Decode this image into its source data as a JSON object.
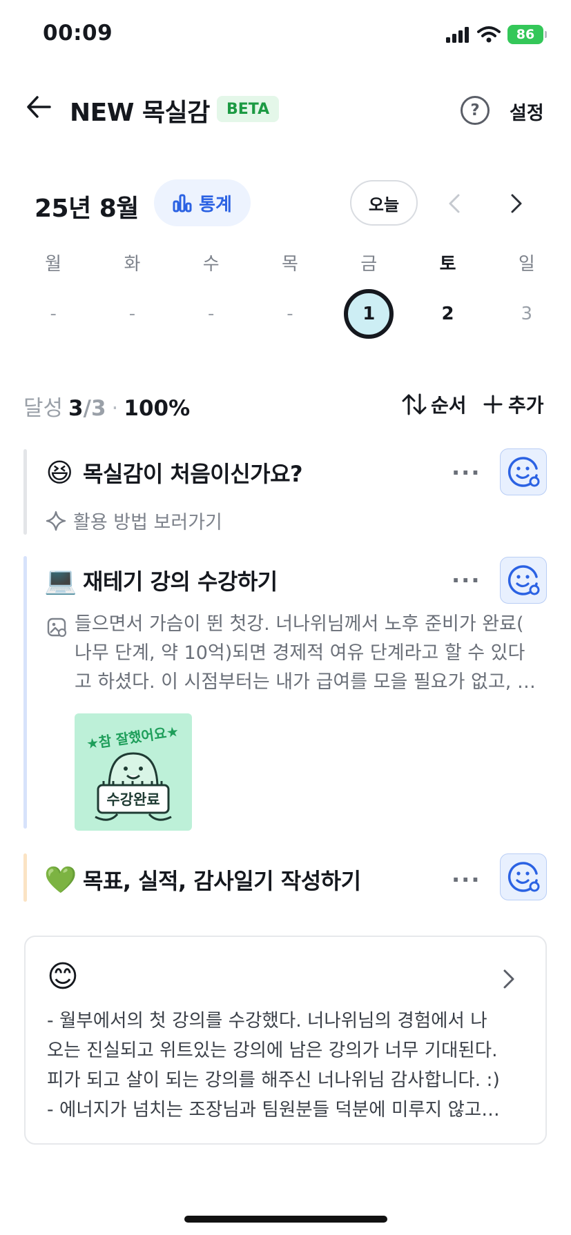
{
  "status_bar": {
    "time": "00:09",
    "battery": "86",
    "icons": [
      "cellular-signal-icon",
      "wifi-icon",
      "battery-charging-icon"
    ]
  },
  "header": {
    "title": "NEW 목실감",
    "badge": "BETA",
    "settings": "설정",
    "help_icon": "question-circle-icon"
  },
  "calendar": {
    "month": "25년 8월",
    "stats_label": "통계",
    "today_label": "오늘",
    "weekdays": [
      "월",
      "화",
      "수",
      "목",
      "금",
      "토",
      "일"
    ],
    "dates": [
      "-",
      "-",
      "-",
      "-",
      "1",
      "2",
      "3"
    ],
    "selected_index": 4
  },
  "progress": {
    "label": "달성",
    "done": "3",
    "total": "/3",
    "separator": "·",
    "percent": "100%",
    "order_label": "순서",
    "add_label": "추가"
  },
  "tasks": [
    {
      "emoji": "😆",
      "title": "목실감이 처음이신가요?",
      "more": "···",
      "sub": "활용 방법 보러가기",
      "bar_color": "#e3e5e8"
    },
    {
      "emoji": "💻",
      "title": "재테기 강의 수강하기",
      "more": "···",
      "memo_lines": [
        "들으면서 가슴이 뛴 첫강. 너나위님께서 노후 준비가 완료(",
        "나무 단계, 약 10억)되면 경제적 여유 단계라고 할 수 있다",
        "고 하셨다. 이 시점부터는 내가 급여를 모을 필요가 없고, …"
      ],
      "sticker_top": "★참 잘했어요★",
      "sticker_bottom": "수강완료",
      "bar_color": "#d7e2fb"
    },
    {
      "emoji": "💚",
      "title": "목표, 실적, 감사일기 작성하기",
      "more": "···",
      "bar_color": "#fbe3c4"
    }
  ],
  "diary": {
    "emoji": "😊",
    "lines": [
      "- 월부에서의 첫 강의를 수강했다. 너나위님의 경험에서 나",
      "오는 진실되고 위트있는 강의에 남은 강의가 너무 기대된다.",
      "피가 되고 살이 되는 강의를 해주신 너나위님 감사합니다. :)",
      "- 에너지가 넘치는 조장님과 팀원분들 덕분에 미루지 않고…"
    ]
  },
  "colors": {
    "accent_blue": "#2b62e3",
    "beta_green": "#1c9a43",
    "selected_day_fill": "#cdeef4"
  }
}
